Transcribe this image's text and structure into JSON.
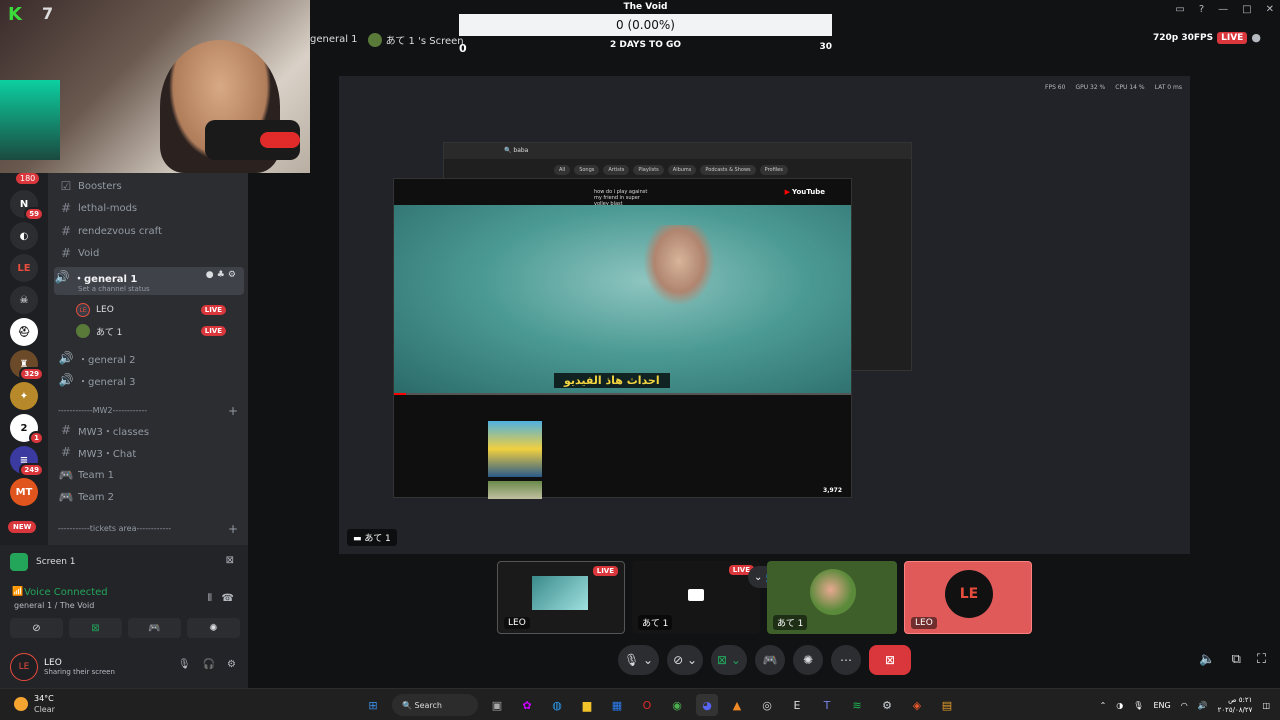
{
  "colors": {
    "accent_live": "#da373c",
    "connected": "#23a55a",
    "rail_bg": "#1e1f22",
    "sidebar_bg": "#2b2d31"
  },
  "rail": {
    "top_badge": "180",
    "servers": [
      {
        "name": "ns",
        "badge": "59"
      },
      {
        "name": "circle"
      },
      {
        "name": "LE"
      },
      {
        "name": "skull"
      },
      {
        "name": "helmet"
      },
      {
        "name": "spartan",
        "badge": "329"
      },
      {
        "name": "gold"
      },
      {
        "name": "2",
        "badge": "1"
      },
      {
        "name": "stripe",
        "badge": "249"
      },
      {
        "name": "MT"
      }
    ],
    "new_label": "NEW"
  },
  "sidebar": {
    "channels": [
      {
        "name": "Boosters",
        "icon": "checkbox-icon"
      },
      {
        "name": "lethal-mods",
        "icon": "hash-icon"
      },
      {
        "name": "rendezvous craft",
        "icon": "hash-icon"
      },
      {
        "name": "Void",
        "icon": "hash-icon"
      }
    ],
    "active_voice": {
      "name": "・general 1",
      "status": "Set a channel status"
    },
    "voice_users": [
      {
        "name": "LEO",
        "badge": "LIVE"
      },
      {
        "name": "あて 1",
        "badge": "LIVE"
      }
    ],
    "voice_more": [
      {
        "name": "・general 2"
      },
      {
        "name": "・general 3"
      }
    ],
    "category_mw2": "------------MW2------------",
    "mw2_channels": [
      {
        "name": "MW3・classes",
        "icon": "hash-icon"
      },
      {
        "name": "MW3・Chat",
        "icon": "hash-icon"
      },
      {
        "name": "Team 1",
        "icon": "speaker-icon"
      },
      {
        "name": "Team 2",
        "icon": "speaker-icon"
      }
    ],
    "category_tickets": "-----------tickets area------------"
  },
  "voice_panel": {
    "screen_label": "Screen 1",
    "connected": "Voice Connected",
    "channel": "general 1 / The Void",
    "user_name": "LEO",
    "user_status": "Sharing their screen"
  },
  "stream": {
    "title_channel": "general 1",
    "title_screen": "あて 1 's Screen",
    "goal_title": "The Void",
    "goal_progress": "0 (0.00%)",
    "goal_days": "2 DAYS TO GO",
    "goal_current": "0",
    "goal_target": "30",
    "quality": "720p 30FPS",
    "live": "LIVE",
    "stats": {
      "fps": "FPS 60",
      "gpu": "GPU 32 %",
      "cpu": "CPU 14 %",
      "lat": "LAT 0 ms"
    },
    "viewer_label": "あて 1"
  },
  "shared": {
    "search_query": "baba",
    "yt_query": "how do i play against my friend in super volley blast",
    "yt_brand": "YouTube",
    "subtitle": "احداث هاذ الفيديو",
    "views": "3,972",
    "tabs": [
      "All",
      "Songs",
      "Artists",
      "Playlists",
      "Albums",
      "Podcasts & Shows",
      "Profiles"
    ]
  },
  "tiles": [
    {
      "name": "LEO",
      "live": "LIVE"
    },
    {
      "name": "あて 1",
      "live": "LIVE"
    },
    {
      "name": "あて 1"
    },
    {
      "name": "LEO"
    }
  ],
  "taskbar": {
    "temp": "34°C",
    "weather": "Clear",
    "search": "Search",
    "lang": "ENG",
    "time": "٥:٢١ ص",
    "date": "٢٠٢٥/٠٨/٢٧"
  }
}
